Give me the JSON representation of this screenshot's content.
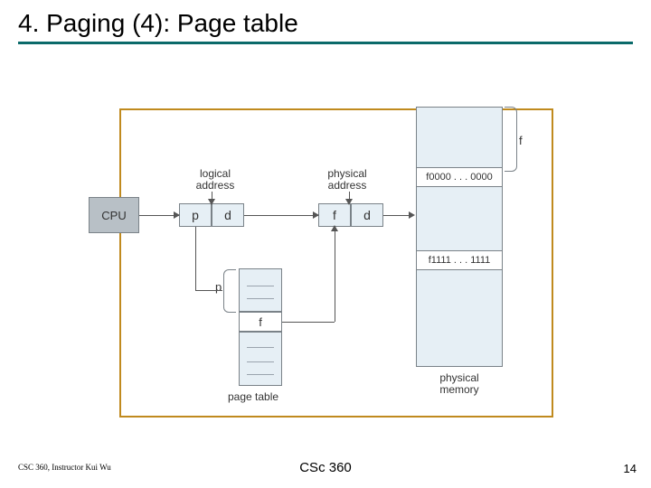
{
  "title": "4. Paging (4): Page table",
  "footer": {
    "left": "CSC 360, Instructor Kui Wu",
    "center": "CSc 360",
    "right": "14"
  },
  "diagram": {
    "cpu": "CPU",
    "logical_label": "logical\naddress",
    "physical_label": "physical\naddress",
    "logical": {
      "p": "p",
      "d": "d"
    },
    "physical": {
      "f": "f",
      "d": "d"
    },
    "page_table": {
      "p_label": "p",
      "f_label": "f",
      "caption": "page table"
    },
    "memory": {
      "row1": "f0000 . . . 0000",
      "row2": "f1111 . . . 1111",
      "caption": "physical\nmemory",
      "brace_label": "f"
    }
  }
}
